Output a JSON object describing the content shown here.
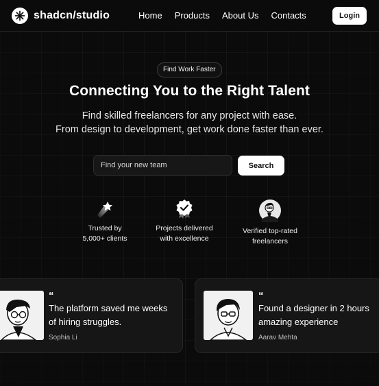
{
  "nav": {
    "brand": "shadcn/studio",
    "links": [
      "Home",
      "Products",
      "About Us",
      "Contacts"
    ],
    "login_label": "Login"
  },
  "hero": {
    "badge": "Find Work Faster",
    "title": "Connecting You to the Right Talent",
    "subtitle_line1": "Find skilled freelancers for any project with ease.",
    "subtitle_line2": "From design to development, get work done faster than ever.",
    "search_placeholder": "Find your new team",
    "search_label": "Search"
  },
  "features": [
    {
      "icon": "shooting-star-icon",
      "line1": "Trusted by",
      "line2": "5,000+ clients"
    },
    {
      "icon": "award-badge-icon",
      "line1": "Projects delivered",
      "line2": "with excellence"
    },
    {
      "icon": "verified-freelancer-icon",
      "line1": "Verified top-rated",
      "line2": "freelancers"
    }
  ],
  "testimonials": [
    {
      "quote_mark": "“",
      "quote": "The platform saved me weeks of hiring struggles.",
      "author": "Sophia Li"
    },
    {
      "quote_mark": "“",
      "quote": "Found a designer in 2 hours amazing experience",
      "author": "Aarav Mehta"
    }
  ],
  "colors": {
    "background": "#0b0b0b",
    "card": "#161616",
    "accent": "#ffffff"
  }
}
